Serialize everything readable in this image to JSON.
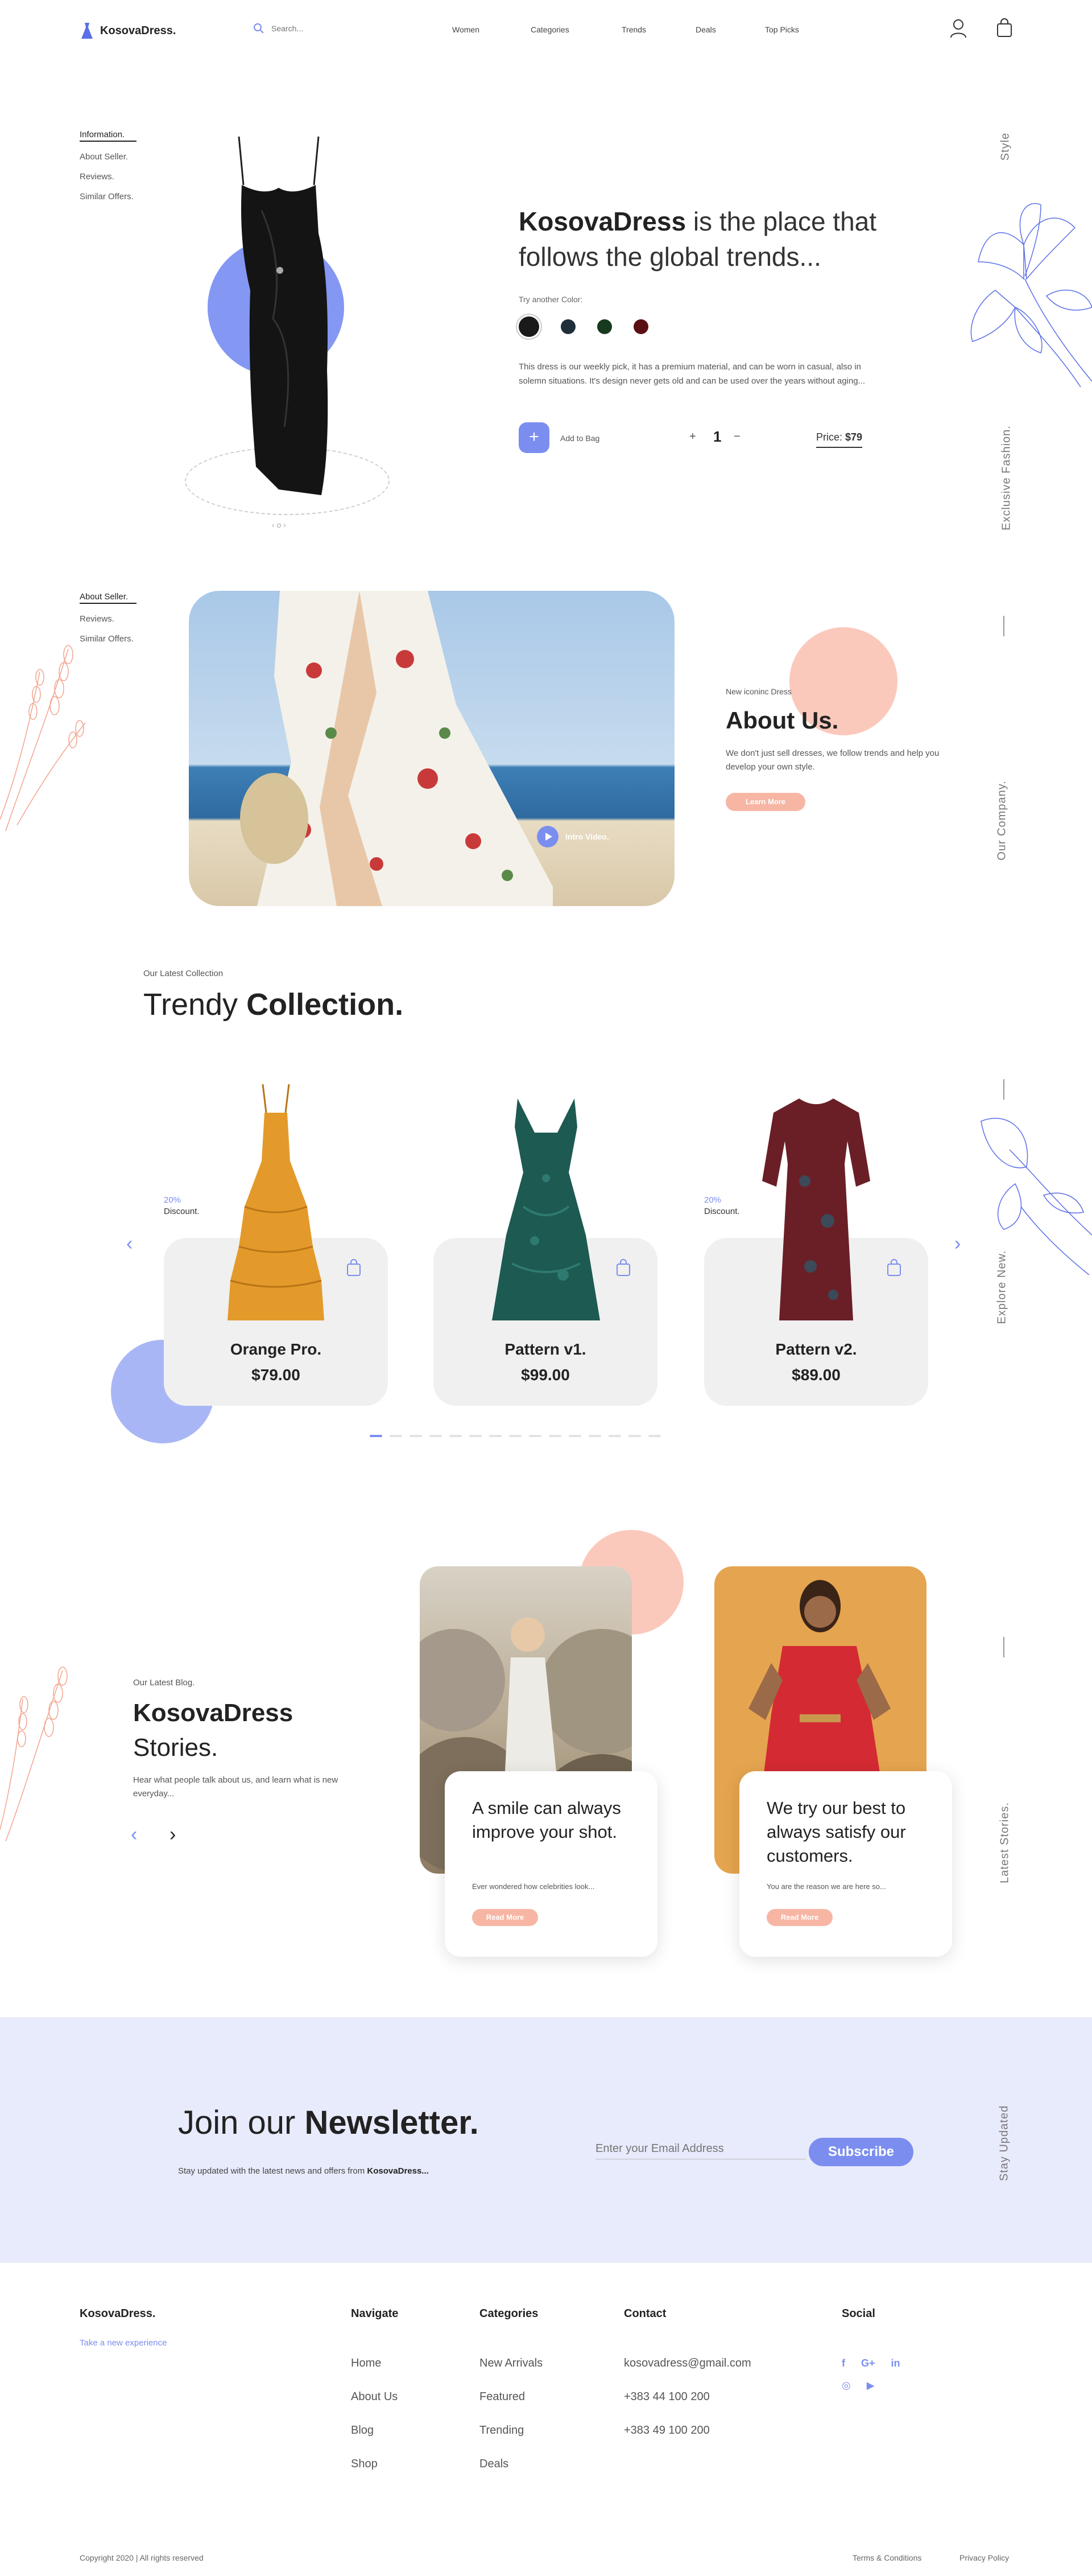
{
  "brand": {
    "name": "KosovaDress.",
    "tagline": "Take a new experience"
  },
  "header": {
    "search_placeholder": "Search...",
    "nav": [
      "Women",
      "Categories",
      "Trends",
      "Deals",
      "Top Picks"
    ]
  },
  "hero": {
    "side_nav": [
      "Information.",
      "About Seller.",
      "Reviews.",
      "Similar Offers."
    ],
    "title_bold": "KosovaDress",
    "title_rest": " is the place that follows the global trends...",
    "color_label": "Try another Color:",
    "colors": [
      "#1a1a1a",
      "#1f2f3a",
      "#173a1e",
      "#5a0f12"
    ],
    "description": "This dress is our weekly pick, it has a premium material, and can be worn in casual, also in solemn situations. It's design never gets old and can be used over the years without aging...",
    "add_label": "Add to Bag",
    "plus": "+",
    "quantity": "1",
    "minus": "−",
    "price_label": "Price:",
    "price": "$79",
    "slider_dots": "‹  o  ›",
    "vertical_top": "Style",
    "vertical_bottom": "Exclusive Fashion."
  },
  "about": {
    "side_nav": [
      "About Seller.",
      "Reviews.",
      "Similar Offers."
    ],
    "video_label": "Intro Video.",
    "eyebrow": "New iconinc Dress",
    "title": "About Us.",
    "text": "We don't just sell dresses, we follow trends and help you develop your own style.",
    "button": "Learn More",
    "vertical": "Our Company."
  },
  "collection": {
    "eyebrow": "Our Latest Collection",
    "title_light": "Trendy ",
    "title_bold": "Collection.",
    "vertical": "Explore New.",
    "products": [
      {
        "name": "Orange Pro.",
        "price": "$79.00",
        "discount": "20%",
        "discount_label": "Discount.",
        "color": "#e39a2b"
      },
      {
        "name": "Pattern v1.",
        "price": "$99.00",
        "discount": "",
        "discount_label": "",
        "color": "#1d5a52"
      },
      {
        "name": "Pattern v2.",
        "price": "$89.00",
        "discount": "20%",
        "discount_label": "Discount.",
        "color": "#6a1f26"
      }
    ]
  },
  "blog": {
    "eyebrow": "Our Latest Blog.",
    "title_bold": "KosovaDress",
    "title_light": "Stories.",
    "text": "Hear what people talk about us, and learn what is new everyday...",
    "vertical": "Latest Stories.",
    "posts": [
      {
        "title": "A smile can always improve your shot.",
        "excerpt": "Ever wondered how celebrities look...",
        "button": "Read More"
      },
      {
        "title": "We try our best to always satisfy our customers.",
        "excerpt": "You are the reason we are here so...",
        "button": "Read More"
      }
    ]
  },
  "newsletter": {
    "title_light": "Join our ",
    "title_bold": "Newsletter.",
    "text": "Stay updated with the latest news and offers from ",
    "text_bold": "KosovaDress...",
    "placeholder": "Enter your Email Address",
    "button": "Subscribe",
    "vertical": "Stay Updated"
  },
  "footer": {
    "navigate_title": "Navigate",
    "navigate": [
      "Home",
      "About Us",
      "Blog",
      "Shop"
    ],
    "categories_title": "Categories",
    "categories": [
      "New Arrivals",
      "Featured",
      "Trending",
      "Deals"
    ],
    "contact_title": "Contact",
    "contact": [
      "kosovadress@gmail.com",
      "+383 44 100 200",
      "+383 49 100 200"
    ],
    "social_title": "Social",
    "social": [
      "f",
      "G+",
      "in",
      "◎",
      "▶"
    ],
    "copyright": "Copyright 2020 | All rights reserved",
    "terms": "Terms & Conditions",
    "privacy": "Privacy Policy"
  },
  "accent": "#7b8ef0",
  "accent_pink": "#f7b6a4"
}
